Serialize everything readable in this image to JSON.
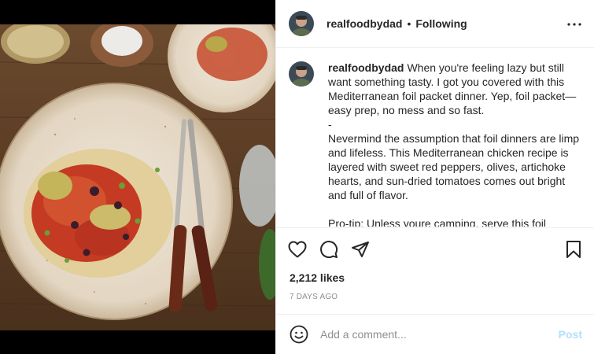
{
  "post": {
    "username": "realfoodbydad",
    "separator": "•",
    "follow_status": "Following",
    "caption": {
      "username": "realfoodbydad",
      "lines": [
        "When you're feeling lazy but still want something tasty. I got you covered with this Mediterranean foil packet dinner. Yep, foil packet—easy prep, no mess and so fast.",
        "-",
        "Nevermind the assumption that foil dinners are limp and lifeless. This Mediterranean chicken recipe is layered with sweet red peppers, olives, artichoke hearts, and sun-dried tomatoes comes out bright and full of flavor.",
        "",
        "Pro-tip: Unless youre camping, serve this foil"
      ]
    },
    "likes": "2,212 likes",
    "timestamp": "7 DAYS AGO"
  },
  "comment": {
    "placeholder": "Add a comment...",
    "post_label": "Post"
  },
  "colors": {
    "text": "#262626",
    "muted": "#8e8e8e",
    "post_disabled": "#b2dffc",
    "divider": "#efefef"
  },
  "icons": {
    "more": "more-horizontal-icon",
    "like": "heart-icon",
    "comment": "comment-icon",
    "share": "share-icon",
    "save": "bookmark-icon",
    "emoji": "emoji-icon"
  }
}
